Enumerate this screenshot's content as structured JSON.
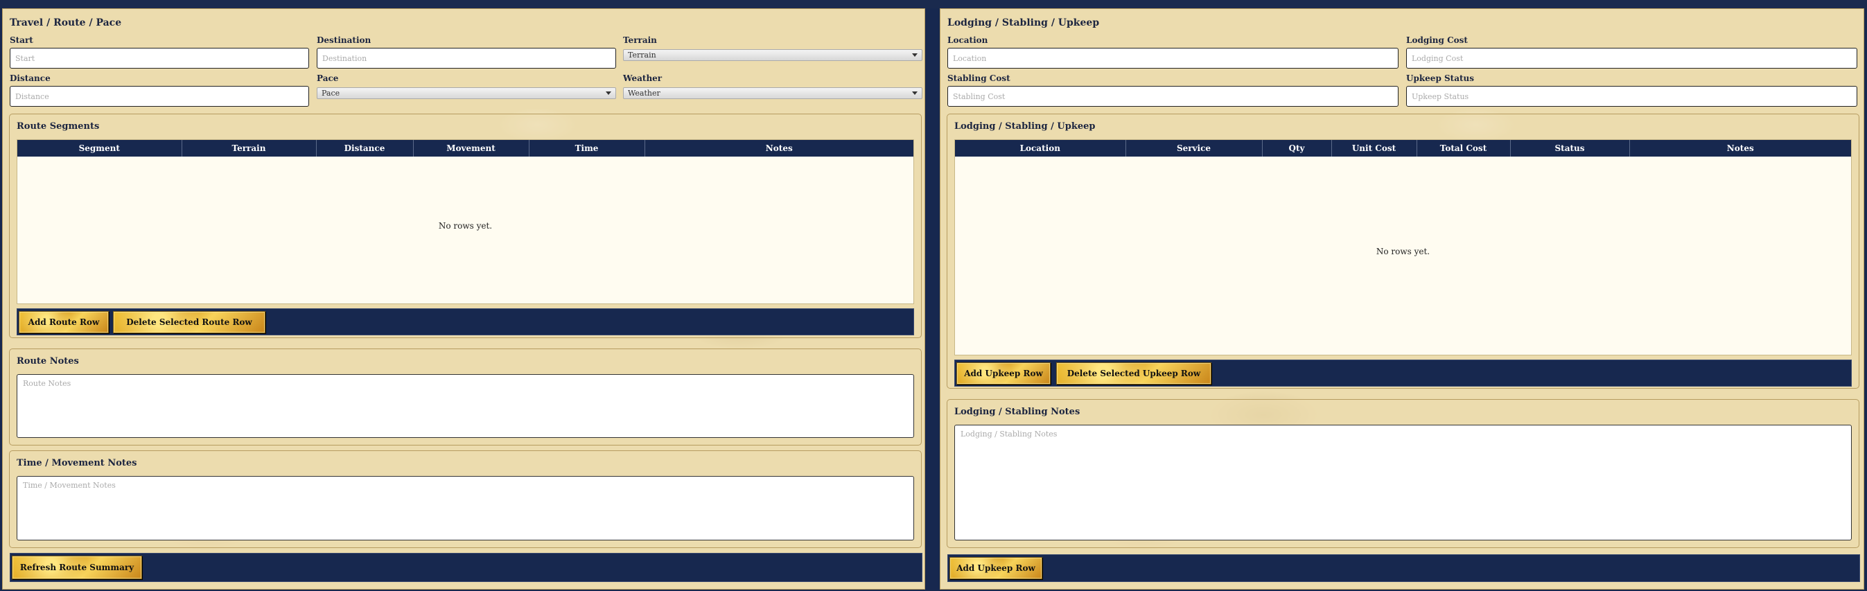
{
  "left": {
    "title": "Travel / Route / Pace",
    "start": {
      "label": "Start",
      "placeholder": "Start"
    },
    "destination": {
      "label": "Destination",
      "placeholder": "Destination"
    },
    "terrain": {
      "label": "Terrain",
      "value": "Terrain"
    },
    "distance": {
      "label": "Distance",
      "placeholder": "Distance"
    },
    "pace": {
      "label": "Pace",
      "value": "Pace"
    },
    "weather": {
      "label": "Weather",
      "value": "Weather"
    },
    "segments": {
      "title": "Route Segments",
      "columns": [
        "Segment",
        "Terrain",
        "Distance",
        "Movement",
        "Time",
        "Notes"
      ],
      "empty": "No rows yet.",
      "add_button": "Add Route Row",
      "delete_button": "Delete Selected Route Row"
    },
    "route_notes": {
      "title": "Route Notes",
      "placeholder": "Route Notes"
    },
    "time_notes": {
      "title": "Time / Movement Notes",
      "placeholder": "Time / Movement Notes"
    },
    "refresh_button": "Refresh Route Summary"
  },
  "right": {
    "title": "Lodging / Stabling / Upkeep",
    "location": {
      "label": "Location",
      "placeholder": "Location"
    },
    "lodging_cost": {
      "label": "Lodging Cost",
      "placeholder": "Lodging Cost"
    },
    "stabling_cost": {
      "label": "Stabling Cost",
      "placeholder": "Stabling Cost"
    },
    "upkeep_status": {
      "label": "Upkeep Status",
      "placeholder": "Upkeep Status"
    },
    "upkeep": {
      "title": "Lodging / Stabling / Upkeep",
      "columns": [
        "Location",
        "Service",
        "Qty",
        "Unit Cost",
        "Total Cost",
        "Status",
        "Notes"
      ],
      "empty": "No rows yet.",
      "add_button": "Add Upkeep Row",
      "delete_button": "Delete Selected Upkeep Row"
    },
    "lodging_notes": {
      "title": "Lodging / Stabling Notes",
      "placeholder": "Lodging / Stabling Notes"
    },
    "bottom_add_button": "Add Upkeep Row"
  },
  "colors": {
    "navy": "#17284f",
    "parchment": "#ecdcae",
    "gold": "#f0c23a"
  }
}
